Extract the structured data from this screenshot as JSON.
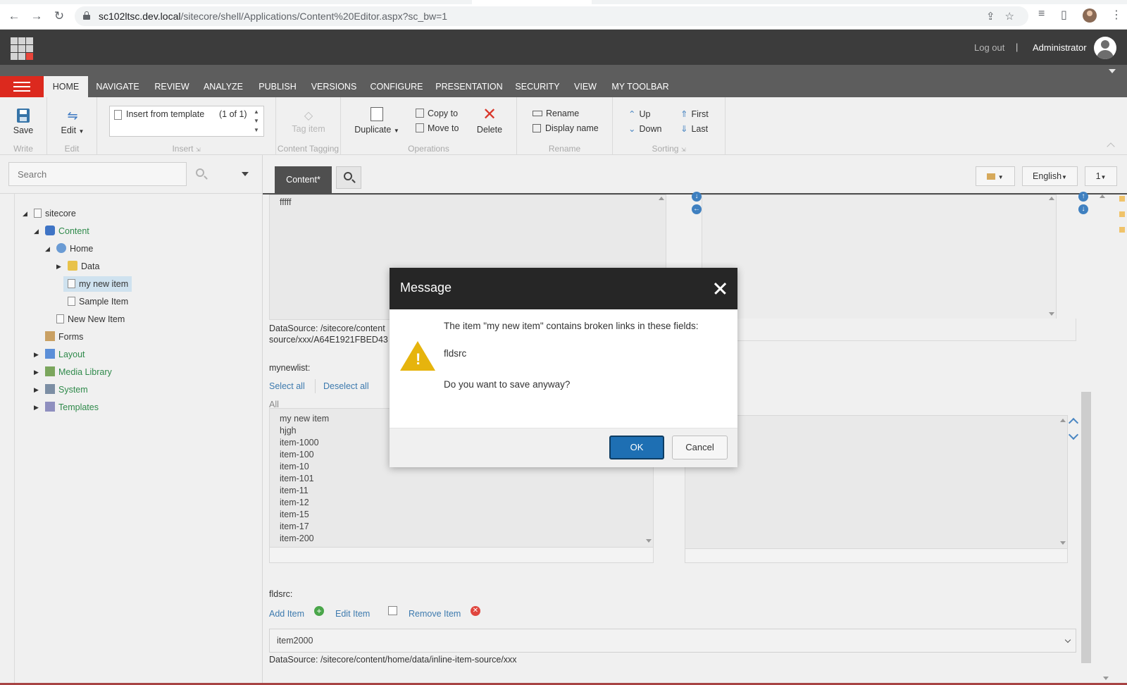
{
  "browser": {
    "url_host": "sc102ltsc.dev.local",
    "url_path": "/sitecore/shell/Applications/Content%20Editor.aspx?sc_bw=1"
  },
  "header": {
    "logout": "Log out",
    "separator": "|",
    "user": "Administrator"
  },
  "ribbon": {
    "tabs": [
      "HOME",
      "NAVIGATE",
      "REVIEW",
      "ANALYZE",
      "PUBLISH",
      "VERSIONS",
      "CONFIGURE",
      "PRESENTATION",
      "SECURITY",
      "VIEW",
      "MY TOOLBAR"
    ],
    "save": "Save",
    "edit": "Edit",
    "insert_template": "Insert from template",
    "insert_count": "(1 of 1)",
    "tag_item": "Tag item",
    "duplicate": "Duplicate",
    "copy_to": "Copy to",
    "move_to": "Move to",
    "delete": "Delete",
    "rename": "Rename",
    "display_name": "Display name",
    "up": "Up",
    "down": "Down",
    "first": "First",
    "last": "Last",
    "groups": {
      "write": "Write",
      "edit": "Edit",
      "insert": "Insert",
      "content_tagging": "Content Tagging",
      "operations": "Operations",
      "rename": "Rename",
      "sorting": "Sorting"
    }
  },
  "search": {
    "placeholder": "Search"
  },
  "tree": {
    "sitecore": "sitecore",
    "content": "Content",
    "home": "Home",
    "data": "Data",
    "my_new_item": "my new item",
    "sample_item": "Sample Item",
    "new_new_item": "New New Item",
    "forms": "Forms",
    "layout": "Layout",
    "media_library": "Media Library",
    "system": "System",
    "templates": "Templates"
  },
  "editor": {
    "tab_label": "Content*",
    "language": "English",
    "version": "1",
    "field_text": "fffff",
    "datasource1_line1": "DataSource: /sitecore/content",
    "datasource1_line2": "source/xxx/A64E1921FBED43",
    "mynewlist_label": "mynewlist:",
    "select_all": "Select all",
    "deselect_all": "Deselect all",
    "all_label": "All",
    "list_items": [
      "my new item",
      "hjgh",
      "item-1000",
      "item-100",
      "item-10",
      "item-101",
      "item-11",
      "item-12",
      "item-15",
      "item-17",
      "item-200"
    ],
    "fldsrc_label": "fldsrc:",
    "add_item": "Add Item",
    "edit_item": "Edit Item",
    "remove_item": "Remove Item",
    "selected_value": "item2000",
    "datasource2": "DataSource: /sitecore/content/home/data/inline-item-source/xxx"
  },
  "modal": {
    "title": "Message",
    "line1": "The item \"my new item\" contains broken links in these fields:",
    "field_name": "fldsrc",
    "question": "Do you want to save anyway?",
    "ok": "OK",
    "cancel": "Cancel"
  },
  "colors": {
    "accent_red": "#dc291e",
    "ok_blue": "#1e6fb3",
    "link_blue": "#3d7aae",
    "tree_green": "#2f8a4b",
    "warning_yellow": "#e6b40d"
  }
}
